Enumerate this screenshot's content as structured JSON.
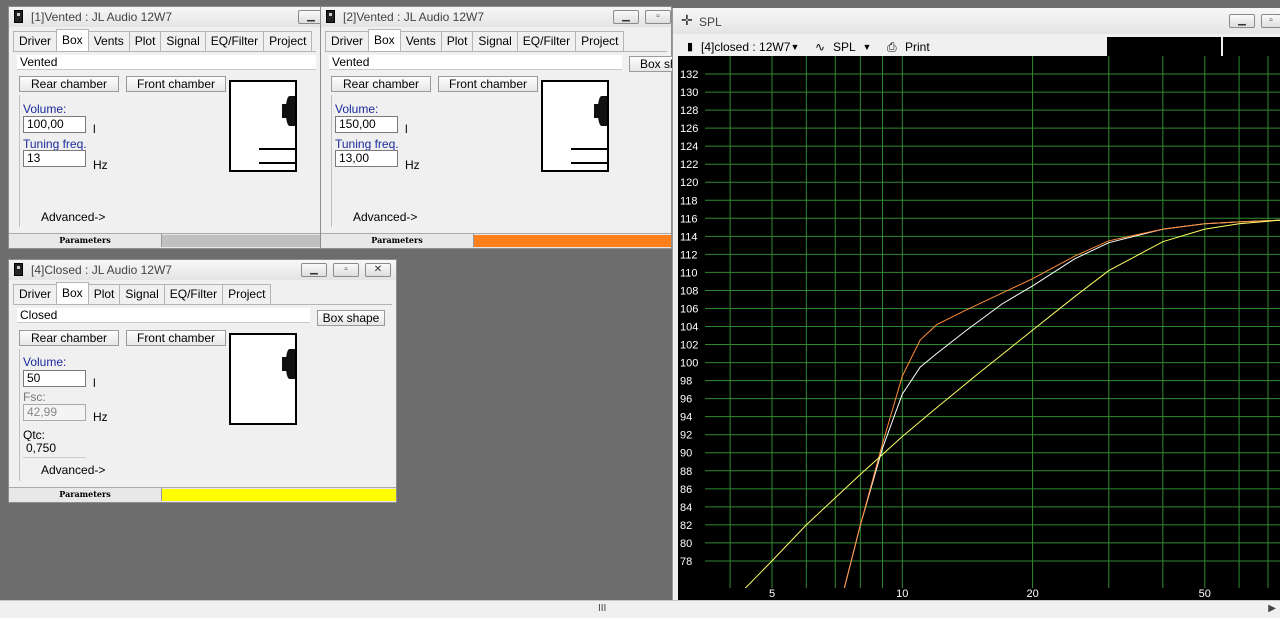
{
  "windows": [
    {
      "id": "w1",
      "title": "[1]Vented : JL Audio 12W7",
      "tabs": [
        "Driver",
        "Box",
        "Vents",
        "Plot",
        "Signal",
        "EQ/Filter",
        "Project"
      ],
      "active_tab": "Box",
      "box_type": "Vented",
      "rear_chamber": "Rear chamber",
      "front_chamber": "Front chamber",
      "fields": [
        {
          "label": "Volume:",
          "value": "100,00",
          "unit": "l"
        },
        {
          "label": "Tuning freq.",
          "value": "13",
          "unit": "Hz"
        }
      ],
      "advanced": "Advanced->",
      "parameters_label": "Parameters",
      "status_color": "#c0c0c0"
    },
    {
      "id": "w2",
      "title": "[2]Vented : JL Audio 12W7",
      "tabs": [
        "Driver",
        "Box",
        "Vents",
        "Plot",
        "Signal",
        "EQ/Filter",
        "Project"
      ],
      "active_tab": "Box",
      "box_type": "Vented",
      "box_shape": "Box sh",
      "rear_chamber": "Rear chamber",
      "front_chamber": "Front chamber",
      "fields": [
        {
          "label": "Volume:",
          "value": "150,00",
          "unit": "l"
        },
        {
          "label": "Tuning freq.",
          "value": "13,00",
          "unit": "Hz"
        }
      ],
      "advanced": "Advanced->",
      "parameters_label": "Parameters",
      "status_color": "#ff7f1a"
    },
    {
      "id": "w4",
      "title": "[4]Closed : JL Audio 12W7",
      "tabs": [
        "Driver",
        "Box",
        "Plot",
        "Signal",
        "EQ/Filter",
        "Project"
      ],
      "active_tab": "Box",
      "box_type": "Closed",
      "box_shape": "Box shape",
      "rear_chamber": "Rear chamber",
      "front_chamber": "Front chamber",
      "fields": [
        {
          "label": "Volume:",
          "value": "50",
          "unit": "l"
        },
        {
          "label": "Fsc:",
          "value": "42,99",
          "unit": "Hz",
          "disabled": true
        },
        {
          "label": "Qtc:",
          "value": "0,750",
          "unit": "",
          "readonly": true
        }
      ],
      "advanced": "Advanced->",
      "parameters_label": "Parameters",
      "status_color": "#ffff00"
    }
  ],
  "spl": {
    "title": "SPL",
    "selector": "[4]closed : 12W7",
    "mode": "SPL",
    "print": "Print",
    "chart_data": {
      "type": "line",
      "x_scale": "log",
      "xlim": [
        3.5,
        75
      ],
      "ylim": [
        75,
        134
      ],
      "x_ticks": [
        5,
        10,
        20,
        50
      ],
      "y_ticks": [
        78,
        80,
        82,
        84,
        86,
        88,
        90,
        92,
        94,
        96,
        98,
        100,
        102,
        104,
        106,
        108,
        110,
        112,
        114,
        116,
        118,
        120,
        122,
        124,
        126,
        128,
        130,
        132
      ],
      "grid": true,
      "series": [
        {
          "color": "#ffffff",
          "x": [
            7.3,
            8,
            9,
            10,
            11,
            12,
            14,
            17,
            20,
            25,
            30,
            40,
            50,
            60,
            75
          ],
          "y": [
            74.5,
            82,
            90.5,
            96.5,
            99.5,
            101,
            103.5,
            106.5,
            108.5,
            111.5,
            113.3,
            114.8,
            115.4,
            115.6,
            115.8
          ]
        },
        {
          "color": "#ff8c3a",
          "x": [
            7.3,
            8,
            9,
            10,
            11,
            12,
            14,
            17,
            20,
            25,
            30,
            40,
            50,
            60,
            75
          ],
          "y": [
            74.5,
            82,
            91,
            98.5,
            102.5,
            104.2,
            105.8,
            107.7,
            109.3,
            111.8,
            113.5,
            114.8,
            115.4,
            115.6,
            115.8
          ]
        },
        {
          "color": "#ffff66",
          "x": [
            4.3,
            5,
            6,
            7,
            8,
            9,
            10,
            12,
            15,
            20,
            25,
            30,
            40,
            50,
            60,
            75
          ],
          "y": [
            74.8,
            78,
            82,
            85,
            87.6,
            89.8,
            91.8,
            95,
            98.8,
            103.6,
            107.3,
            110.2,
            113.4,
            114.8,
            115.4,
            115.8
          ]
        }
      ]
    }
  },
  "scrollbar": {
    "grip": "III",
    "arrow": "▶"
  }
}
